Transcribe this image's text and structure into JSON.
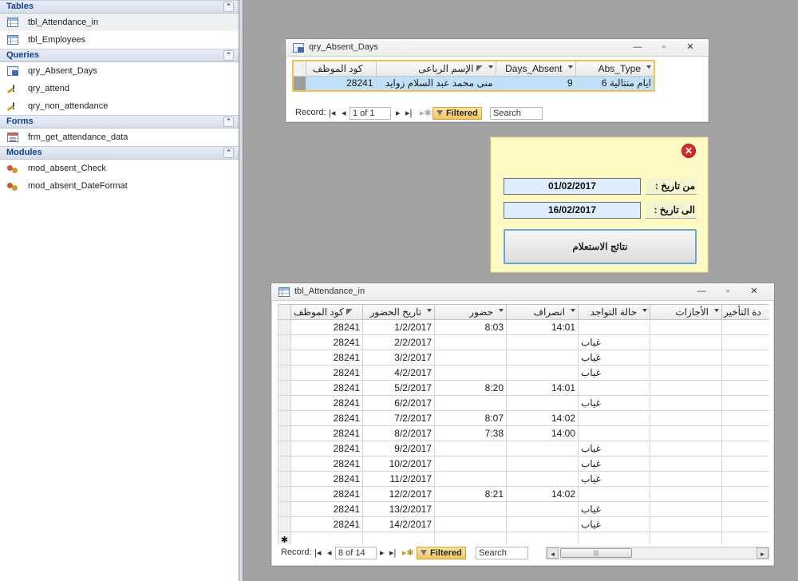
{
  "nav": {
    "groups": [
      {
        "title": "Tables",
        "items": [
          {
            "label": "tbl_Attendance_in",
            "icon": "table-icon"
          },
          {
            "label": "tbl_Employees",
            "icon": "table-icon"
          }
        ]
      },
      {
        "title": "Queries",
        "items": [
          {
            "label": "qry_Absent_Days",
            "icon": "select-query-icon"
          },
          {
            "label": "qry_attend",
            "icon": "action-query-icon"
          },
          {
            "label": "qry_non_attendance",
            "icon": "action-query-icon"
          }
        ]
      },
      {
        "title": "Forms",
        "items": [
          {
            "label": "frm_get_attendance_data",
            "icon": "form-icon"
          }
        ]
      },
      {
        "title": "Modules",
        "items": [
          {
            "label": "mod_absent_Check",
            "icon": "module-icon"
          },
          {
            "label": "mod_absent_DateFormat",
            "icon": "module-icon"
          }
        ]
      }
    ],
    "collapse_glyph": "⌃"
  },
  "query_window": {
    "title": "qry_Absent_Days",
    "columns": [
      "كود الموظف",
      "الإسم الرباعى",
      "Days_Absent",
      "Abs_Type"
    ],
    "rows": [
      {
        "emp_code": "28241",
        "name": "منى محمد عبد السلام زوايد",
        "days": "9",
        "abs_type": "6 ايام متتالية"
      }
    ],
    "navbar": {
      "record_label": "Record:",
      "position": "1 of 1",
      "filter": "Filtered",
      "search": "Search"
    }
  },
  "param_form": {
    "from_label": "من تاريخ :",
    "from_value": "01/02/2017",
    "to_label": "الى تاريخ :",
    "to_value": "16/02/2017",
    "button": "نتائج الاستعلام",
    "close": "✕"
  },
  "table_window": {
    "title": "tbl_Attendance_in",
    "columns": [
      "كود الموظف",
      "تاريخ الحضور",
      "حضور",
      "انصراف",
      "حالة التواجد",
      "الأجازات",
      "دة التأخير"
    ],
    "rows": [
      {
        "code": "28241",
        "date": "1/2/2017",
        "in": "8:03",
        "out": "14:01",
        "status": ""
      },
      {
        "code": "28241",
        "date": "2/2/2017",
        "in": "",
        "out": "",
        "status": "غياب"
      },
      {
        "code": "28241",
        "date": "3/2/2017",
        "in": "",
        "out": "",
        "status": "غياب"
      },
      {
        "code": "28241",
        "date": "4/2/2017",
        "in": "",
        "out": "",
        "status": "غياب"
      },
      {
        "code": "28241",
        "date": "5/2/2017",
        "in": "8:20",
        "out": "14:01",
        "status": ""
      },
      {
        "code": "28241",
        "date": "6/2/2017",
        "in": "",
        "out": "",
        "status": "غياب"
      },
      {
        "code": "28241",
        "date": "7/2/2017",
        "in": "8:07",
        "out": "14:02",
        "status": ""
      },
      {
        "code": "28241",
        "date": "8/2/2017",
        "in": "7:38",
        "out": "14:00",
        "status": ""
      },
      {
        "code": "28241",
        "date": "9/2/2017",
        "in": "",
        "out": "",
        "status": "غياب"
      },
      {
        "code": "28241",
        "date": "10/2/2017",
        "in": "",
        "out": "",
        "status": "غياب"
      },
      {
        "code": "28241",
        "date": "11/2/2017",
        "in": "",
        "out": "",
        "status": "غياب"
      },
      {
        "code": "28241",
        "date": "12/2/2017",
        "in": "8:21",
        "out": "14:02",
        "status": ""
      },
      {
        "code": "28241",
        "date": "13/2/2017",
        "in": "",
        "out": "",
        "status": "غياب"
      },
      {
        "code": "28241",
        "date": "14/2/2017",
        "in": "",
        "out": "",
        "status": "غياب"
      }
    ],
    "new_row_marker": "✱",
    "navbar": {
      "record_label": "Record:",
      "position": "8 of 14",
      "filter": "Filtered",
      "search": "Search"
    }
  }
}
